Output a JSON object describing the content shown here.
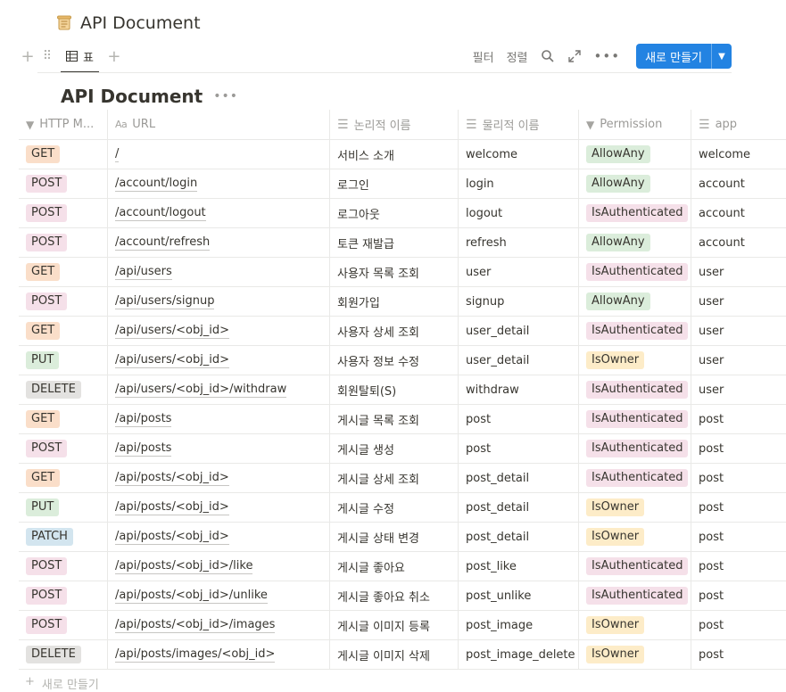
{
  "page": {
    "title": "API Document"
  },
  "toolbar": {
    "view_tab_label": "표",
    "filter_label": "필터",
    "sort_label": "정렬",
    "new_button_label": "새로 만들기"
  },
  "database": {
    "title": "API Document"
  },
  "table": {
    "columns": [
      {
        "label": "HTTP M...",
        "icon": "select-icon"
      },
      {
        "label": "URL",
        "icon": "title-icon"
      },
      {
        "label": "논리적 이름",
        "icon": "text-icon"
      },
      {
        "label": "물리적 이름",
        "icon": "text-icon"
      },
      {
        "label": "Permission",
        "icon": "select-icon"
      },
      {
        "label": "app",
        "icon": "text-icon"
      }
    ],
    "rows": [
      {
        "method": "GET",
        "url": "/",
        "logical": "서비스 소개",
        "physical": "welcome",
        "permission": "AllowAny",
        "app": "welcome"
      },
      {
        "method": "POST",
        "url": "/account/login",
        "logical": "로그인",
        "physical": "login",
        "permission": "AllowAny",
        "app": "account"
      },
      {
        "method": "POST",
        "url": "/account/logout",
        "logical": "로그아웃",
        "physical": "logout",
        "permission": "IsAuthenticated",
        "app": "account"
      },
      {
        "method": "POST",
        "url": "/account/refresh",
        "logical": "토큰 재발급",
        "physical": "refresh",
        "permission": "AllowAny",
        "app": "account"
      },
      {
        "method": "GET",
        "url": "/api/users",
        "logical": "사용자 목록 조회",
        "physical": "user",
        "permission": "IsAuthenticated",
        "app": "user"
      },
      {
        "method": "POST",
        "url": "/api/users/signup",
        "logical": "회원가입",
        "physical": "signup",
        "permission": "AllowAny",
        "app": "user"
      },
      {
        "method": "GET",
        "url": "/api/users/<obj_id>",
        "logical": "사용자 상세 조회",
        "physical": "user_detail",
        "permission": "IsAuthenticated",
        "app": "user"
      },
      {
        "method": "PUT",
        "url": "/api/users/<obj_id>",
        "logical": "사용자 정보 수정",
        "physical": "user_detail",
        "permission": "IsOwner",
        "app": "user"
      },
      {
        "method": "DELETE",
        "url": "/api/users/<obj_id>/withdraw",
        "logical": "회원탈퇴(S)",
        "physical": "withdraw",
        "permission": "IsAuthenticated",
        "app": "user"
      },
      {
        "method": "GET",
        "url": "/api/posts",
        "logical": "게시글 목록 조회",
        "physical": "post",
        "permission": "IsAuthenticated",
        "app": "post"
      },
      {
        "method": "POST",
        "url": "/api/posts",
        "logical": "게시글 생성",
        "physical": "post",
        "permission": "IsAuthenticated",
        "app": "post"
      },
      {
        "method": "GET",
        "url": "/api/posts/<obj_id>",
        "logical": "게시글 상세 조회",
        "physical": "post_detail",
        "permission": "IsAuthenticated",
        "app": "post"
      },
      {
        "method": "PUT",
        "url": "/api/posts/<obj_id>",
        "logical": "게시글 수정",
        "physical": "post_detail",
        "permission": "IsOwner",
        "app": "post"
      },
      {
        "method": "PATCH",
        "url": "/api/posts/<obj_id>",
        "logical": "게시글 상태 변경",
        "physical": "post_detail",
        "permission": "IsOwner",
        "app": "post"
      },
      {
        "method": "POST",
        "url": "/api/posts/<obj_id>/like",
        "logical": "게시글 좋아요",
        "physical": "post_like",
        "permission": "IsAuthenticated",
        "app": "post"
      },
      {
        "method": "POST",
        "url": "/api/posts/<obj_id>/unlike",
        "logical": "게시글 좋아요 취소",
        "physical": "post_unlike",
        "permission": "IsAuthenticated",
        "app": "post"
      },
      {
        "method": "POST",
        "url": "/api/posts/<obj_id>/images",
        "logical": "게시글 이미지 등록",
        "physical": "post_image",
        "permission": "IsOwner",
        "app": "post"
      },
      {
        "method": "DELETE",
        "url": "/api/posts/images/<obj_id>",
        "logical": "게시글 이미지 삭제",
        "physical": "post_image_delete",
        "permission": "IsOwner",
        "app": "post"
      }
    ],
    "new_row_label": "새로 만들기"
  },
  "colors": {
    "accent": "#2383e2",
    "GET": "#fadec9",
    "POST": "#f5e0e9",
    "PUT": "#dbeddb",
    "DELETE": "#e3e2e0",
    "PATCH": "#d3e5ef",
    "AllowAny": "#dbeddb",
    "IsAuthenticated": "#f5e0e9",
    "IsOwner": "#fdecc8"
  }
}
